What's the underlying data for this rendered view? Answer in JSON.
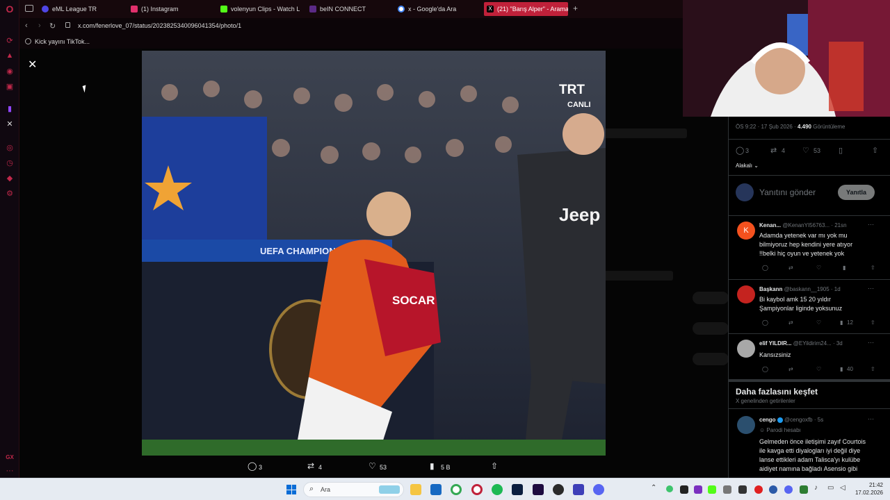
{
  "browser": {
    "tabs": [
      {
        "label": "eML League TR",
        "color": "#4f46e5"
      },
      {
        "label": "(1) Instagram",
        "color": "#e1306c"
      },
      {
        "label": "volenyun Clips - Watch Li",
        "color": "#53fc18"
      },
      {
        "label": "beIN CONNECT",
        "color": "#5b2a86"
      },
      {
        "label": "x - Google'da Ara",
        "color": "#4285f4"
      },
      {
        "label": "(21) \"Barış Alper\" - Arama",
        "color": "#000000"
      }
    ],
    "url": "x.com/fenerlove_07/status/2023825340096041354/photo/1",
    "bookmark": "Kick yayını TikTok..."
  },
  "photo": {
    "overlay_logo_top": "TRT",
    "overlay_logo_bottom": "CANLI",
    "banner": "UEFA CHAMPIONS LEA",
    "shirt_sponsor": "SOCAR",
    "opponent_sponsor": "Jeep"
  },
  "photo_actions": {
    "replies": "3",
    "reposts": "4",
    "likes": "53",
    "views": "5 B"
  },
  "tweet": {
    "time": "ÖS 9:22 · 17 Şub 2026 ·",
    "views_count": "4.490",
    "views_label": "Görüntüleme",
    "replies": "3",
    "reposts": "4",
    "likes": "53",
    "relevance": "Alakalı",
    "reply_placeholder": "Yanıtını gönder",
    "reply_button": "Yanıtla"
  },
  "replies": [
    {
      "name": "Kenan...",
      "handle": "@KenanYI56763...",
      "age": "21sn",
      "avatar_letter": "K",
      "text": [
        "Adamda yetenek var mı yok mu",
        "bilmiyoruz hep kendini yere atıyor",
        "!!belki hiç oyun ve yetenek yok"
      ],
      "views": ""
    },
    {
      "name": "Başkann",
      "handle": "@baskann__1905",
      "age": "1d",
      "avatar_letter": "",
      "text": [
        "Bi kaybol amk 15 20 yıldır",
        "Şampiyonlar liginde yoksunuz"
      ],
      "views": "12"
    },
    {
      "name": "elif YILDIR...",
      "handle": "@EYildirim24...",
      "age": "3d",
      "avatar_letter": "",
      "text": [
        "Kansızsiniz"
      ],
      "views": "40"
    }
  ],
  "explore": {
    "title": "Daha fazlasını keşfet",
    "subtitle": "X genelinden getirilenler",
    "post": {
      "name": "cengo",
      "handle": "@cengoxfb",
      "age": "5s",
      "tag": "Parodi hesabı",
      "text": [
        "Gelmeden önce iletişimi zayıf Courtois",
        "ile kavga etti diyalogları iyi değil diye",
        "lanse ettikleri adam Talisca'yı kulübe",
        "aidiyet namına bağladı Asensio gibi"
      ]
    }
  },
  "taskbar": {
    "search": "Ara",
    "time": "21:42",
    "date": "17.02.2026"
  },
  "colors": {
    "opera_red": "#c0213a",
    "x_blue": "#1d9bf0",
    "avatar_orange": "#f4511e"
  }
}
